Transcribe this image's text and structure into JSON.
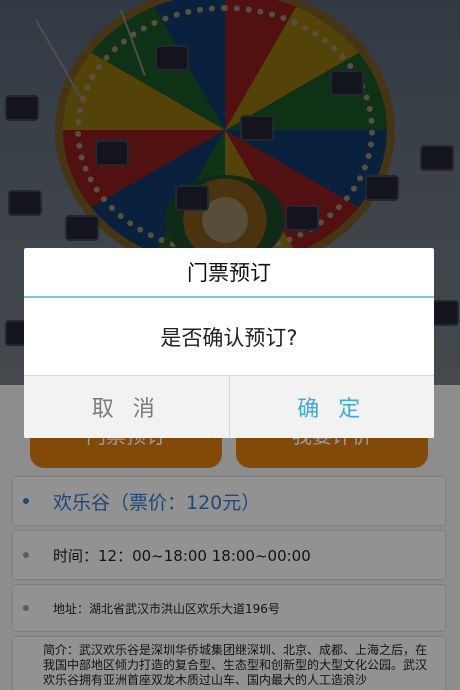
{
  "hero": {
    "image": "swing-ride-photo"
  },
  "actions": {
    "left_label": "门票预订",
    "right_label": "我要评价"
  },
  "details": {
    "name_price": "欢乐谷（票价：120元）",
    "time": "时间：12：00~18:00 18:00~00:00",
    "address": "地址：湖北省武汉市洪山区欢乐大道196号",
    "intro": "简介：武汉欢乐谷是深圳华侨城集团继深圳、北京、成都、上海之后，在我国中部地区倾力打造的复合型、生态型和创新型的大型文化公园。武汉欢乐谷拥有亚洲首座双龙木质过山车、国内最大的人工造浪沙"
  },
  "dialog": {
    "title": "门票预订",
    "message": "是否确认预订?",
    "cancel_label": "取 消",
    "confirm_label": "确 定"
  },
  "colors": {
    "accent_blue": "#42a9dc",
    "orange": "#d97a10",
    "link_blue": "#3a78c5"
  }
}
